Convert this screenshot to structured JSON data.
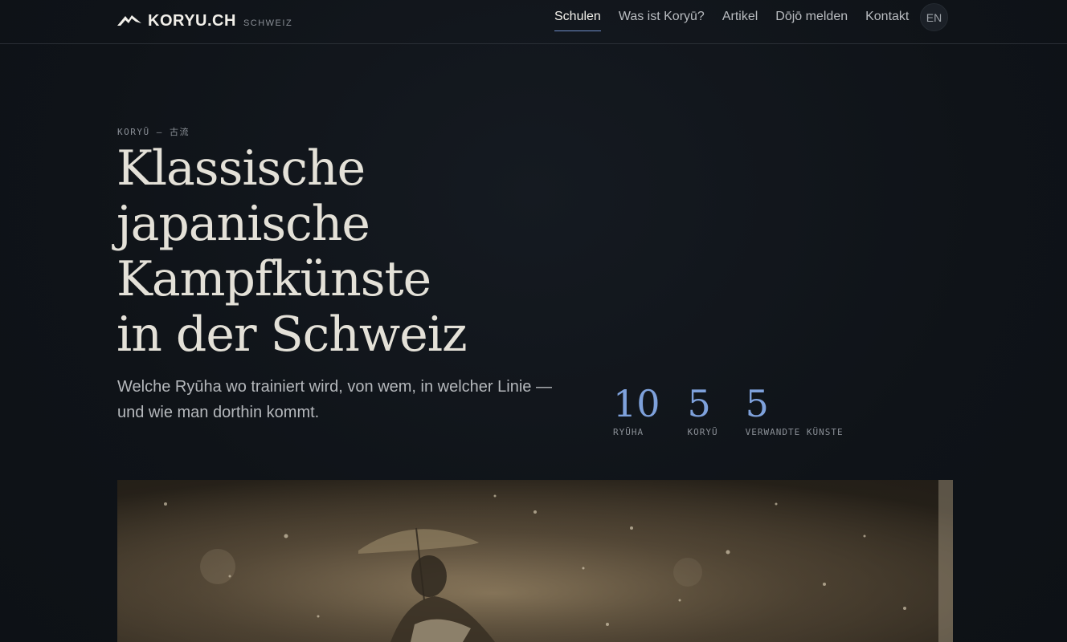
{
  "header": {
    "logo_text": "KORYU.CH",
    "logo_sub": "SCHWEIZ",
    "logo_icon": "mountain-wing-icon",
    "nav": [
      {
        "label": "Schulen",
        "active": true
      },
      {
        "label": "Was ist Koryū?",
        "active": false
      },
      {
        "label": "Artikel",
        "active": false
      },
      {
        "label": "Dōjō melden",
        "active": false
      },
      {
        "label": "Kontakt",
        "active": false
      }
    ],
    "lang_button": "EN"
  },
  "hero": {
    "eyebrow": "KORYŪ — 古流",
    "title_lines": [
      "Klassische",
      "japanische",
      "Kampfkünste",
      "in der Schweiz"
    ],
    "subline": "Welche Ryūha wo trainiert wird, von wem, in welcher Linie — und wie man dorthin kommt."
  },
  "stats": [
    {
      "value": "10",
      "label": "RYŪHA"
    },
    {
      "value": "5",
      "label": "KORYŪ"
    },
    {
      "value": "5",
      "label": "VERWANDTE KÜNSTE"
    }
  ],
  "colors": {
    "background": "#0f1318",
    "accent": "#7ea1db",
    "title": "#e4e1d8"
  }
}
